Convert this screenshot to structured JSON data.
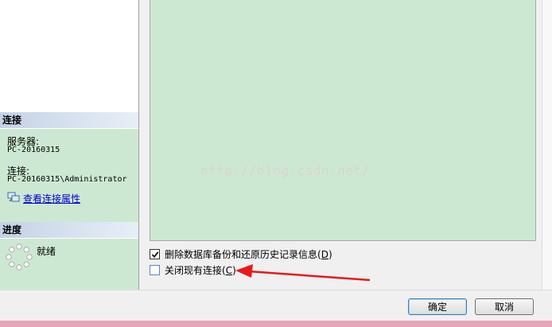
{
  "sidebar": {
    "connection": {
      "header": "连接",
      "server_label": "服务器:",
      "server_value": "PC-20160315",
      "connection_label": "连接:",
      "connection_value": "PC-20160315\\Administrator",
      "view_link": "查看连接属性"
    },
    "progress": {
      "header": "进度",
      "status": "就绪"
    }
  },
  "main": {
    "watermark": "http://blog.csdn.net/",
    "options": [
      {
        "label": "删除数据库备份和还原历史记录信息",
        "hotkey": "D",
        "checked": true
      },
      {
        "label": "关闭现有连接",
        "hotkey": "C",
        "checked": false
      }
    ]
  },
  "buttons": {
    "ok_label": "确定",
    "cancel_label": "取消"
  },
  "colors": {
    "panel_green": "#cde8d2",
    "annotation_arrow": "#e8191b",
    "link_blue": "#0000cc",
    "bottom_edge": "#e8a4b8"
  }
}
